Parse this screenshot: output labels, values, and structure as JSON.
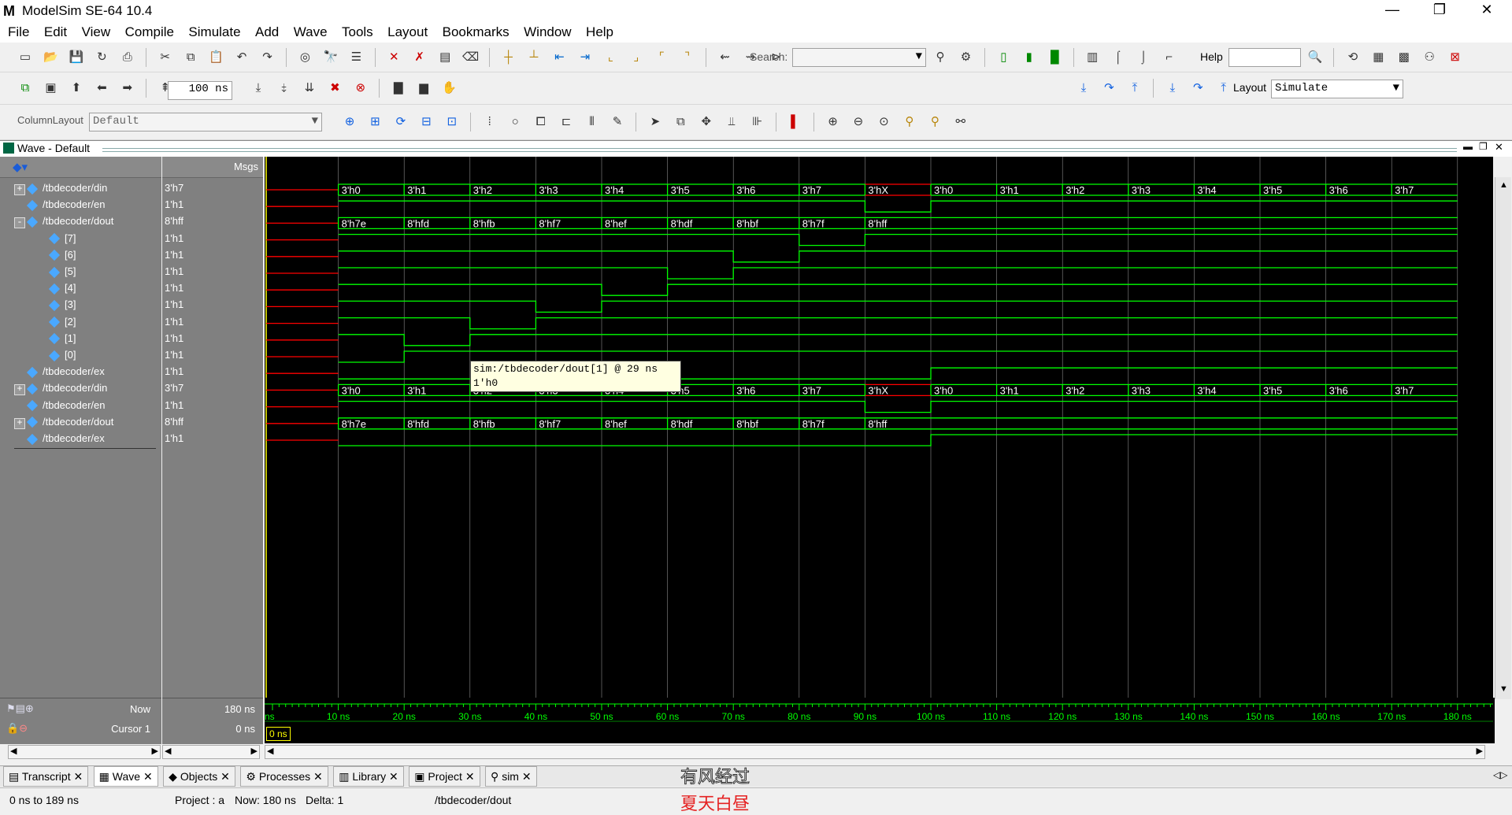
{
  "window": {
    "title": "ModelSim SE-64 10.4",
    "logo": "M",
    "controls": [
      "—",
      "❐",
      "✕"
    ]
  },
  "menu": [
    "File",
    "Edit",
    "View",
    "Compile",
    "Simulate",
    "Add",
    "Wave",
    "Tools",
    "Layout",
    "Bookmarks",
    "Window",
    "Help"
  ],
  "toolbar": {
    "search_label": "Search:",
    "help_label": "Help",
    "layout_label": "Layout",
    "layout_value": "Simulate",
    "run_length": "100 ns",
    "column_layout_label": "ColumnLayout",
    "column_layout_value": "Default"
  },
  "wave": {
    "title": "Wave - Default",
    "msgs_header": "Msgs",
    "signals": [
      {
        "name": "/tbdecoder/din",
        "msg": "3'h7",
        "expand": "+",
        "indent": 0
      },
      {
        "name": "/tbdecoder/en",
        "msg": "1'h1",
        "expand": "",
        "indent": 0
      },
      {
        "name": "/tbdecoder/dout",
        "msg": "8'hff",
        "expand": "-",
        "indent": 0
      },
      {
        "name": "[7]",
        "msg": "1'h1",
        "expand": "",
        "indent": 1
      },
      {
        "name": "[6]",
        "msg": "1'h1",
        "expand": "",
        "indent": 1
      },
      {
        "name": "[5]",
        "msg": "1'h1",
        "expand": "",
        "indent": 1
      },
      {
        "name": "[4]",
        "msg": "1'h1",
        "expand": "",
        "indent": 1
      },
      {
        "name": "[3]",
        "msg": "1'h1",
        "expand": "",
        "indent": 1
      },
      {
        "name": "[2]",
        "msg": "1'h1",
        "expand": "",
        "indent": 1
      },
      {
        "name": "[1]",
        "msg": "1'h1",
        "expand": "",
        "indent": 1
      },
      {
        "name": "[0]",
        "msg": "1'h1",
        "expand": "",
        "indent": 1
      },
      {
        "name": "/tbdecoder/ex",
        "msg": "1'h1",
        "expand": "",
        "indent": 0
      },
      {
        "name": "/tbdecoder/din",
        "msg": "3'h7",
        "expand": "+",
        "indent": 0
      },
      {
        "name": "/tbdecoder/en",
        "msg": "1'h1",
        "expand": "",
        "indent": 0
      },
      {
        "name": "/tbdecoder/dout",
        "msg": "8'hff",
        "expand": "+",
        "indent": 0
      },
      {
        "name": "/tbdecoder/ex",
        "msg": "1'h1",
        "expand": "",
        "indent": 0
      }
    ],
    "din_labels": [
      "3'h0",
      "3'h1",
      "3'h2",
      "3'h3",
      "3'h4",
      "3'h5",
      "3'h6",
      "3'h7",
      "3'hX",
      "3'h0",
      "3'h1",
      "3'h2",
      "3'h3",
      "3'h4",
      "3'h5",
      "3'h6",
      "3'h7"
    ],
    "dout_labels": [
      "8'h7e",
      "8'hfd",
      "8'hfb",
      "8'hf7",
      "8'hef",
      "8'hdf",
      "8'hbf",
      "8'h7f",
      "8'hff"
    ],
    "time_ticks": [
      "10 ns",
      "20 ns",
      "30 ns",
      "40 ns",
      "50 ns",
      "60 ns",
      "70 ns",
      "80 ns",
      "90 ns",
      "100 ns",
      "110 ns",
      "120 ns",
      "130 ns",
      "140 ns",
      "150 ns",
      "160 ns",
      "170 ns",
      "180 ns"
    ],
    "time_first_tick": "ns",
    "now_label": "Now",
    "now_value": "180 ns",
    "cursor_label": "Cursor 1",
    "cursor_value": "0 ns",
    "cursor_flag": "0 ns",
    "tooltip_line1": "sim:/tbdecoder/dout[1] @ 29 ns",
    "tooltip_line2": "1'h0"
  },
  "tabs": [
    "Transcript",
    "Wave",
    "Objects",
    "Processes",
    "Library",
    "Project",
    "sim"
  ],
  "status": {
    "range": "0 ns to 189 ns",
    "project": "Project : a",
    "now": "Now: 180 ns",
    "delta": "Delta: 1",
    "path": "/tbdecoder/dout"
  },
  "watermark": {
    "line1": "有风经过",
    "line2": "夏天白昼"
  },
  "colors": {
    "wave": "#00c000",
    "wave_bright": "#00ff00",
    "undefined": "#ff0000",
    "cursor": "#ffff00",
    "name_bg": "#808080"
  }
}
